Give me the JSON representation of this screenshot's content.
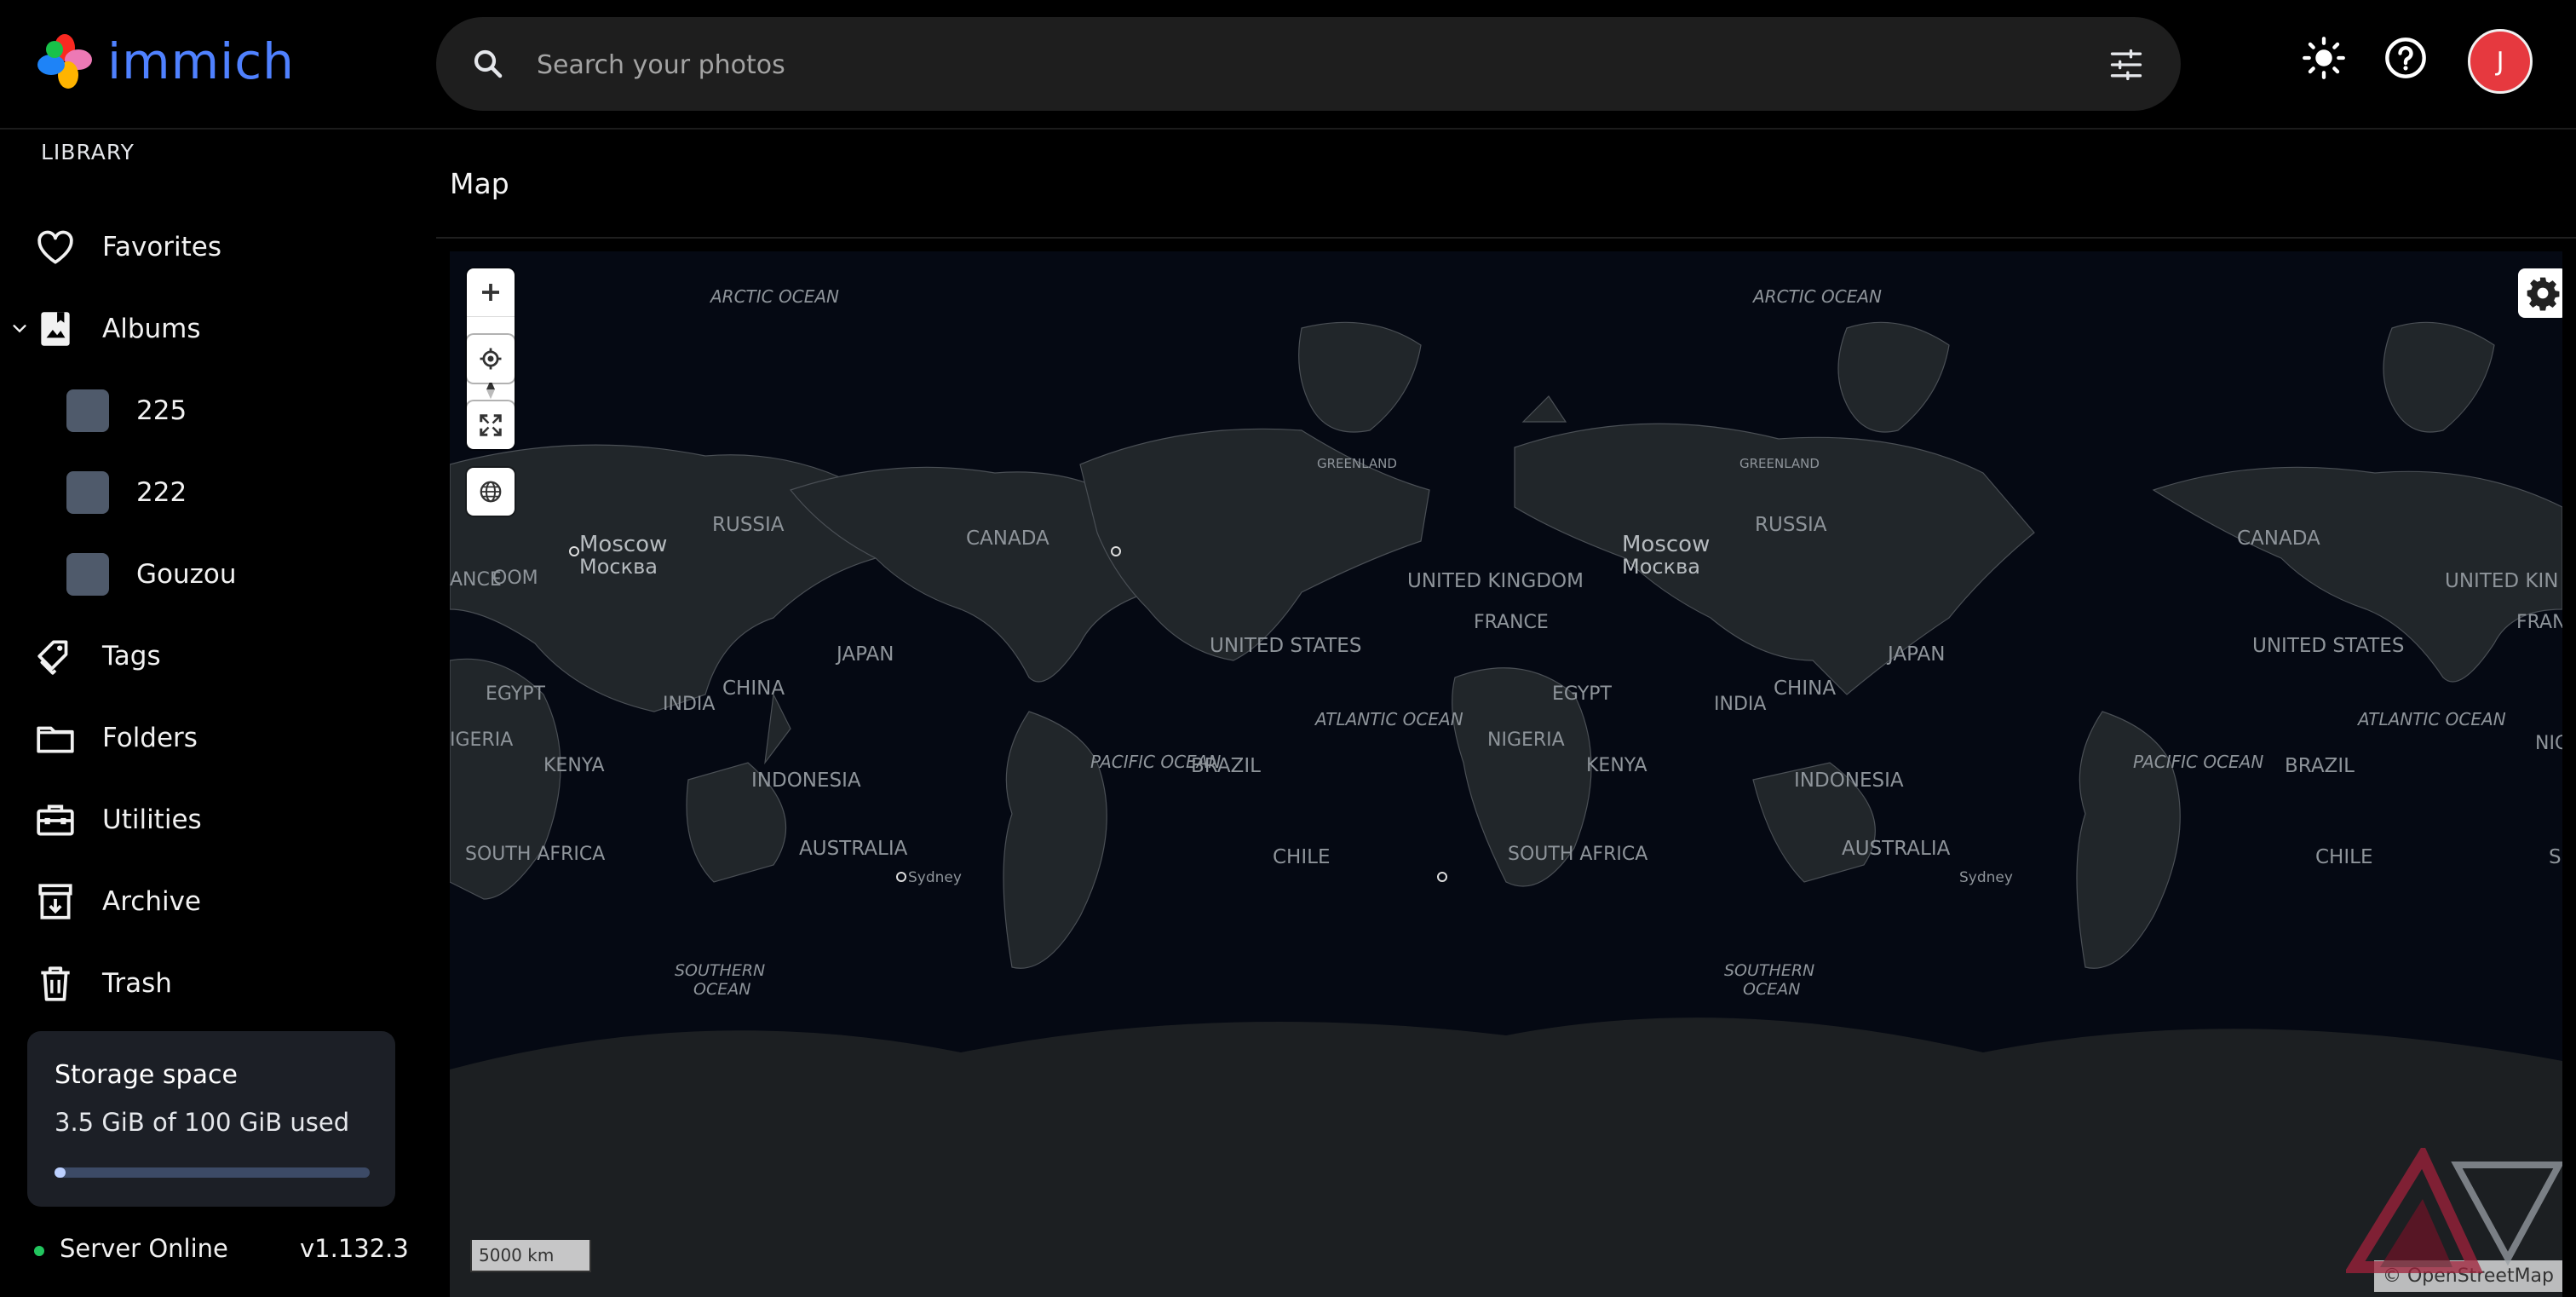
{
  "app": {
    "name": "immich"
  },
  "search": {
    "placeholder": "Search your photos",
    "value": ""
  },
  "header_icons": [
    "search-icon",
    "filter-icon",
    "sun-icon",
    "help-icon"
  ],
  "user": {
    "initial": "J",
    "avatar_color": "#e6393f"
  },
  "sidebar": {
    "heading": "LIBRARY",
    "items": [
      {
        "label": "Favorites",
        "icon": "heart-icon"
      },
      {
        "label": "Albums",
        "icon": "album-icon",
        "expanded": true
      },
      {
        "label": "Tags",
        "icon": "tag-icon"
      },
      {
        "label": "Folders",
        "icon": "folder-icon"
      },
      {
        "label": "Utilities",
        "icon": "toolbox-icon"
      },
      {
        "label": "Archive",
        "icon": "archive-icon"
      },
      {
        "label": "Trash",
        "icon": "trash-icon"
      }
    ],
    "albums": [
      {
        "label": "225"
      },
      {
        "label": "222"
      },
      {
        "label": "Gouzou"
      }
    ]
  },
  "storage": {
    "title": "Storage space",
    "used_text": "3.5 GiB of 100 GiB used",
    "used_fraction": 0.035
  },
  "server": {
    "status": "Server Online",
    "version": "v1.132.3",
    "status_color": "#22c55e"
  },
  "page": {
    "title": "Map"
  },
  "map": {
    "scale_label": "5000 km",
    "attribution": "© OpenStreetMap",
    "labels": {
      "arctic": "ARCTIC OCEAN",
      "russia": "RUSSIA",
      "canada": "CANADA",
      "greenland": "GREENLAND",
      "moscow": "Moscow",
      "moscow_ru": "Москва",
      "uk": "UNITED KINGDOM",
      "uk_cut": "UNITED KIN",
      "france": "FRANCE",
      "fran_cut": "FRAN",
      "china": "CHINA",
      "japan": "JAPAN",
      "us": "UNITED STATES",
      "egypt": "EGYPT",
      "india": "INDIA",
      "nigeria": "NIGERIA",
      "kenya": "KENYA",
      "indonesia": "INDONESIA",
      "australia": "AUSTRALIA",
      "sydney": "Sydney",
      "south_africa": "SOUTH AFRICA",
      "atlantic": "ATLANTIC OCEAN",
      "pacific": "PACIFIC OCEAN",
      "brazil": "BRAZIL",
      "chile": "CHILE",
      "southern": "SOUTHERN",
      "ocean": "OCEAN",
      "nic_cut": "NIC",
      "s_cut": "S",
      "nigeria_cut": "IGERIA",
      "oom_cut": "OOM",
      "ance_cut": "ANCE"
    }
  }
}
